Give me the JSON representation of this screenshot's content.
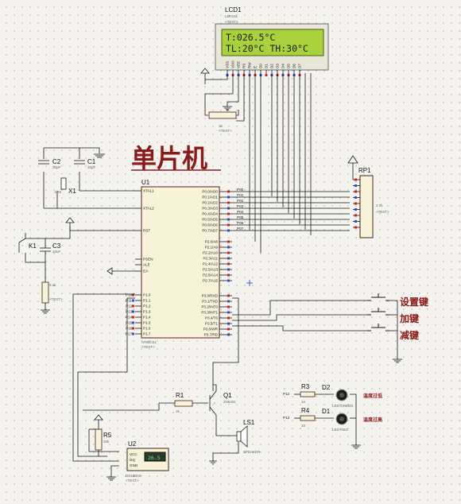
{
  "title": "单片机",
  "lcd": {
    "ref": "LCD1",
    "model": "LM016L",
    "line1": "T:026.5°C",
    "line2": "TL:20°C TH:30°C",
    "pins": [
      "VSS",
      "VDD",
      "VEE",
      "RS",
      "RW",
      "E",
      "D0",
      "D1",
      "D2",
      "D3",
      "D4",
      "D5",
      "D6",
      "D7"
    ]
  },
  "mcu": {
    "ref": "U1",
    "model": "AT89C51",
    "left_pins": [
      "XTAL1",
      "XTAL2",
      "RST",
      "PSEN",
      "ALE",
      "EA",
      "P1.0",
      "P1.1",
      "P1.2",
      "P1.3",
      "P1.4",
      "P1.5",
      "P1.6",
      "P1.7"
    ],
    "right_p0": [
      "P0.0/AD0",
      "P0.1/AD1",
      "P0.2/AD2",
      "P0.3/AD3",
      "P0.4/AD4",
      "P0.5/AD5",
      "P0.6/AD6",
      "P0.7/AD7"
    ],
    "right_p2": [
      "P2.0/A8",
      "P2.1/A9",
      "P2.2/A10",
      "P2.3/A11",
      "P2.4/A12",
      "P2.5/A13",
      "P2.6/A14",
      "P2.7/A15"
    ],
    "right_p3": [
      "P3.0/RXD",
      "P3.1/TXD",
      "P3.2/INT0",
      "P3.3/INT1",
      "P3.4/T0",
      "P3.5/T1",
      "P3.6/WR",
      "P3.7/RD"
    ],
    "p0_nets": [
      "P00",
      "P01",
      "P02",
      "P03",
      "P04",
      "P05",
      "P06",
      "P07"
    ],
    "left_nets": [
      "P10",
      "P11",
      "P12",
      "P13",
      "P14",
      "P15",
      "P16",
      "P17"
    ]
  },
  "components": {
    "c1": "C1",
    "c1_val": "30pF",
    "c2": "C2",
    "c2_val": "30pF",
    "x1": "X1",
    "x1_val": "12M",
    "k1": "K1",
    "c3": "C3",
    "c3_val": "10uF",
    "r_rst_val": "5.1k",
    "rp1": "RP1",
    "rp1_val": "4.7k",
    "r_pot_val": "1k",
    "r1": "R1",
    "r1_val": "1k",
    "q1": "Q1",
    "q1_val": "2N5401",
    "ls1": "LS1",
    "ls1_val": "SPEAKER",
    "r3": "R3",
    "r3_val": "10",
    "r4": "R4",
    "r4_val": "10",
    "d2": "D2",
    "d2_val": "LED-GREEN",
    "d1": "D1",
    "d1_val": "LED-RED",
    "r5": "R5",
    "r5_val": "10k",
    "u2": "U2",
    "u2_model": "DS18B20",
    "u2_reading": "26.5",
    "u2_pins": [
      "VCC",
      "DQ",
      "GND"
    ],
    "net_p12": "P12",
    "net_p13": "P13",
    "text": "<TEXT>"
  },
  "buttons": {
    "set": "设置键",
    "plus": "加键",
    "minus": "减键"
  },
  "led_labels": {
    "green": "温度过低",
    "red": "温度过高"
  }
}
